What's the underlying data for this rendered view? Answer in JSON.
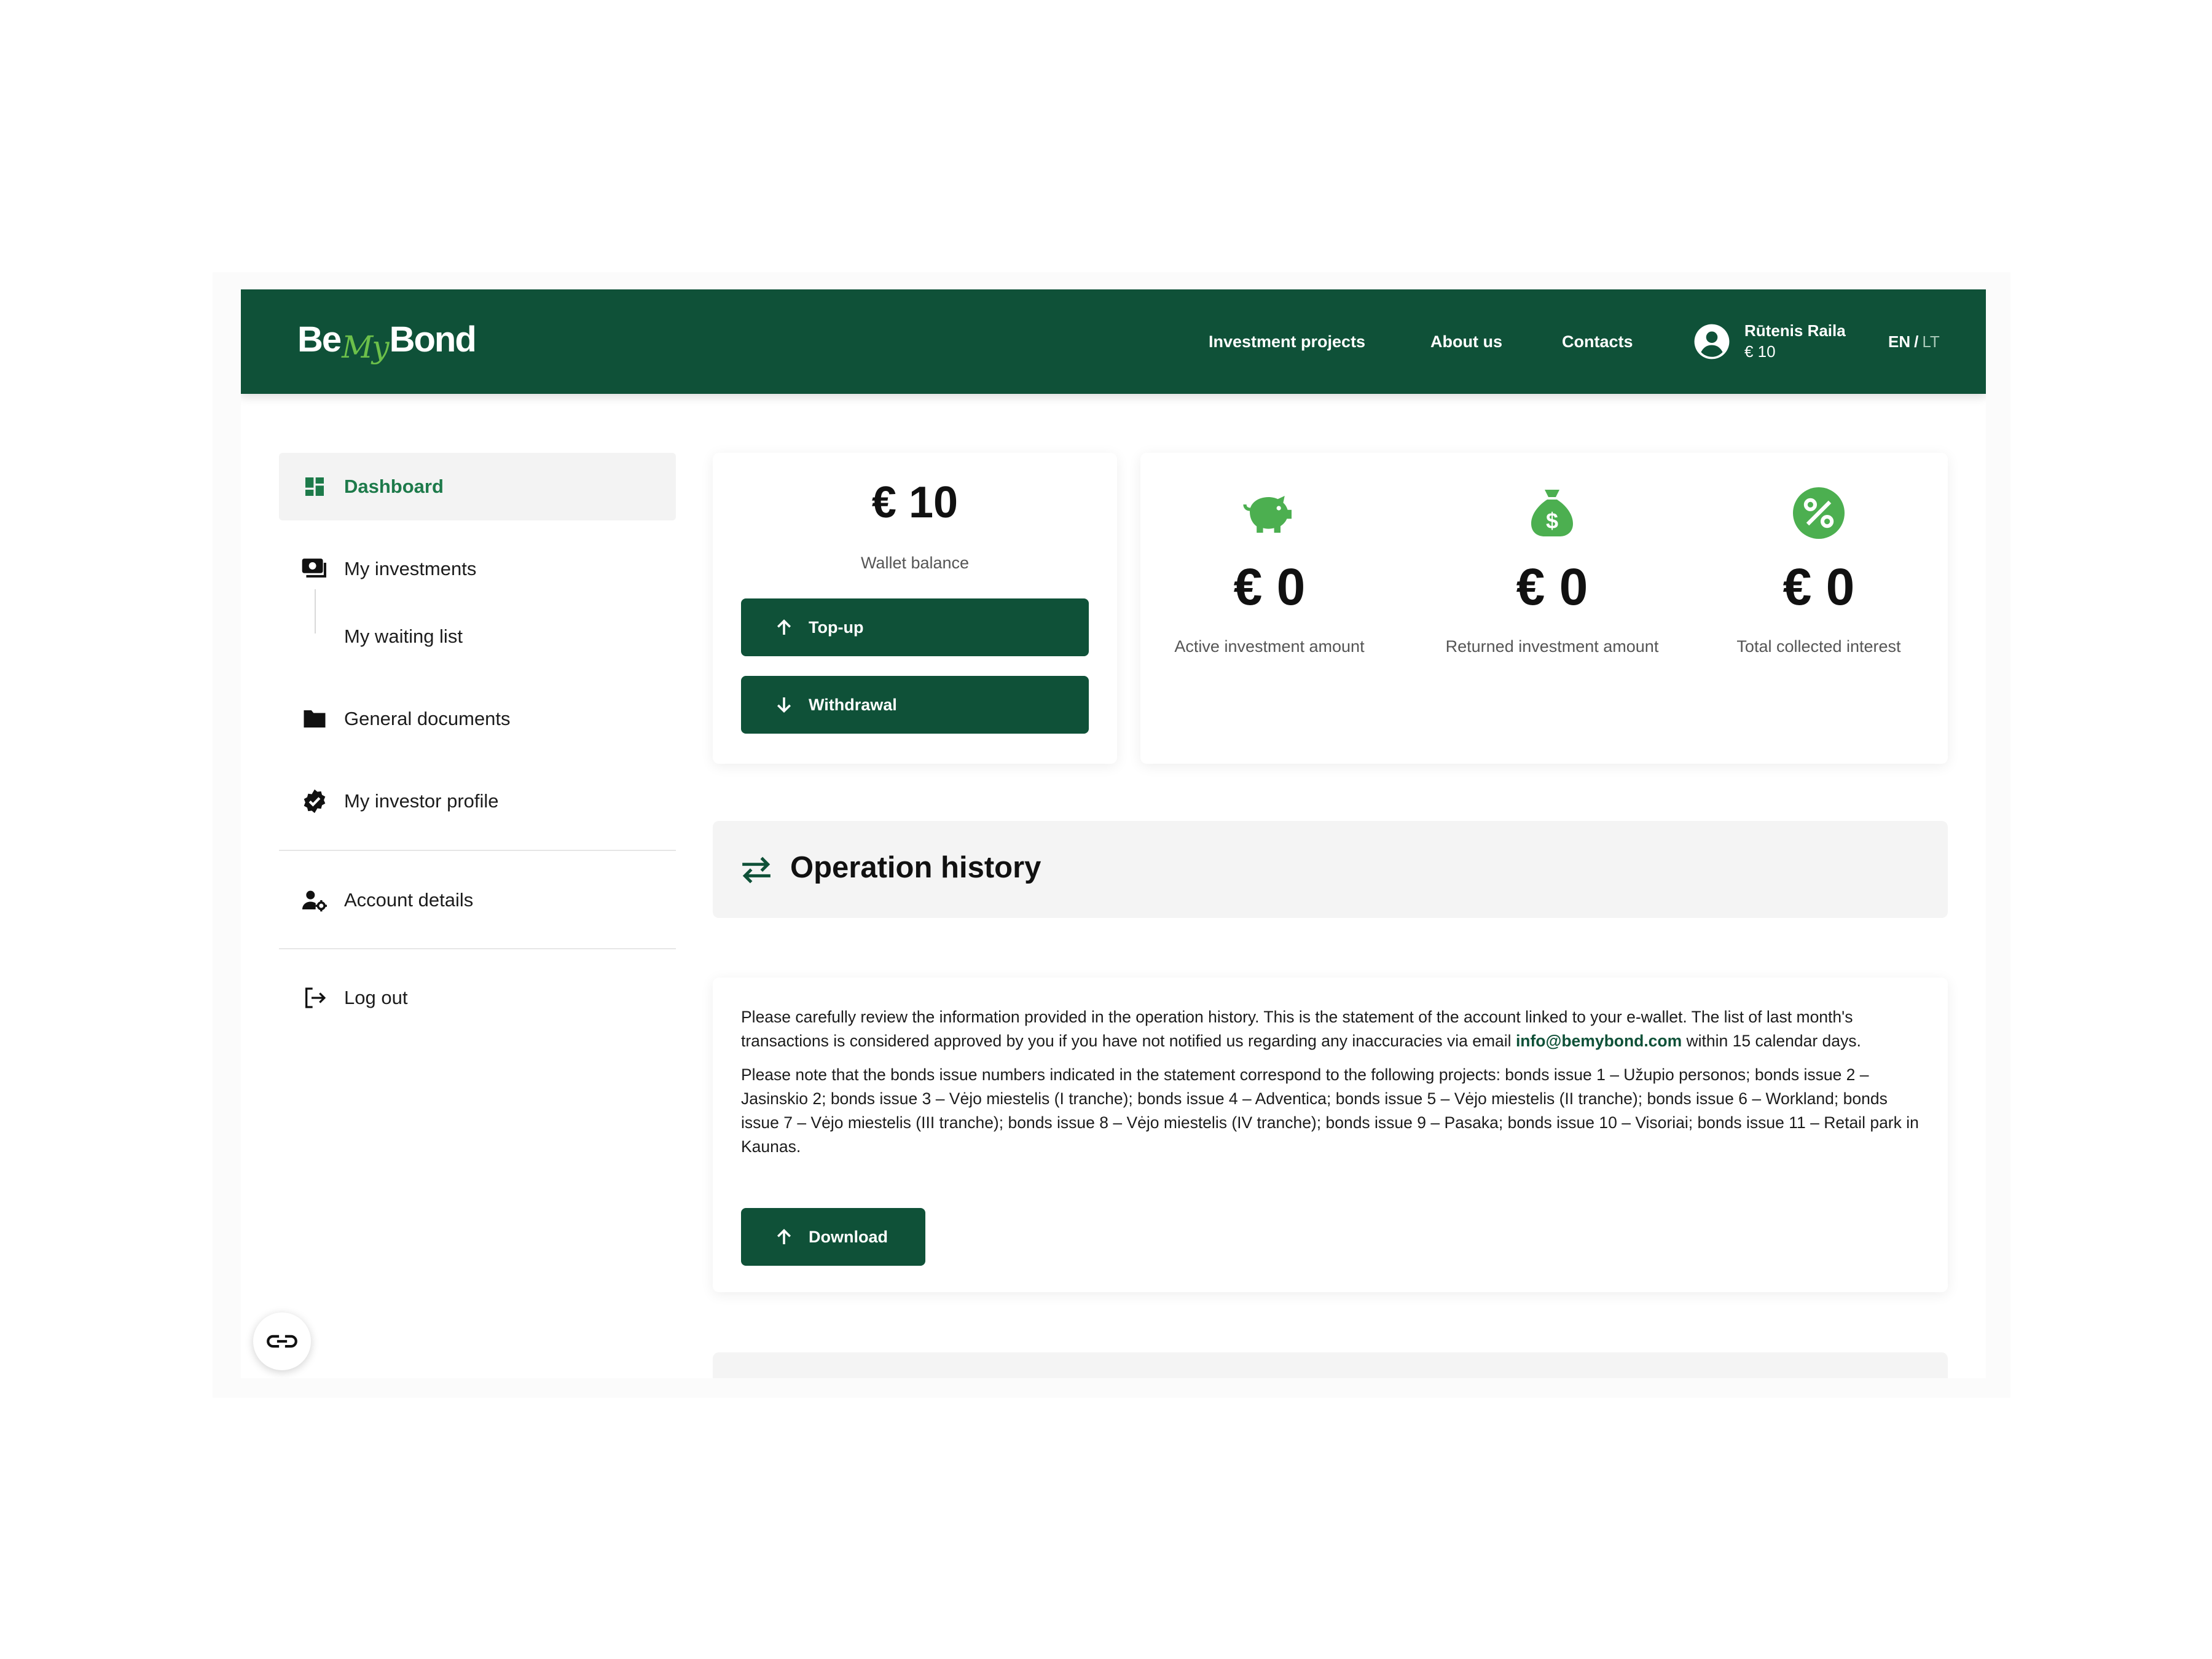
{
  "header": {
    "logo": {
      "be": "Be",
      "my": "My",
      "bond": "Bond"
    },
    "nav": [
      "Investment projects",
      "About us",
      "Contacts"
    ],
    "user": {
      "name": "Rūtenis Raila",
      "balance": "€ 10"
    },
    "lang": {
      "active": "EN",
      "separator": "/",
      "inactive": "LT"
    }
  },
  "sidebar": {
    "items": [
      {
        "label": "Dashboard",
        "icon": "dashboard-icon",
        "active": true
      },
      {
        "label": "My investments",
        "icon": "money-icon"
      },
      {
        "label": "My waiting list",
        "icon": ""
      },
      {
        "label": "General documents",
        "icon": "folder-icon"
      },
      {
        "label": "My investor profile",
        "icon": "verified-badge-icon"
      },
      {
        "label": "Account details",
        "icon": "user-settings-icon"
      },
      {
        "label": "Log out",
        "icon": "logout-icon"
      }
    ]
  },
  "wallet": {
    "amount": "€ 10",
    "label": "Wallet balance",
    "topup_label": "Top-up",
    "withdraw_label": "Withdrawal"
  },
  "stats": [
    {
      "value": "€ 0",
      "label": "Active investment amount",
      "icon": "piggy-bank-icon"
    },
    {
      "value": "€ 0",
      "label": "Returned investment amount",
      "icon": "money-bag-icon"
    },
    {
      "value": "€ 0",
      "label": "Total collected interest",
      "icon": "percent-icon"
    }
  ],
  "operation_history": {
    "title": "Operation history",
    "p1_before": "Please carefully review the information provided in the operation history. This is the statement of the account linked to your e-wallet. The list of last month's transactions is considered approved by you if you have not notified us regarding any inaccuracies via email ",
    "p1_email": "info@bemybond.com",
    "p1_after": " within 15 calendar days.",
    "p2": "Please note that the bonds issue numbers indicated in the statement correspond to the following projects: bonds issue 1 – Užupio personos; bonds issue 2 – Jasinskio 2; bonds issue 3 – Vėjo miestelis (I tranche); bonds issue 4 – Adventica; bonds issue 5 – Vėjo miestelis (II tranche); bonds issue 6 – Workland; bonds issue 7 – Vėjo miestelis (III tranche); bonds issue 8 – Vėjo miestelis (IV tranche); bonds issue 9 – Pasaka; bonds issue 10 – Visoriai; bonds issue 11 – Retail park in Kaunas.",
    "download_label": "Download"
  },
  "colors": {
    "brand_dark": "#0f5138",
    "brand_light": "#6cc04a",
    "active_text": "#1d7a4a",
    "stat_icon": "#4caf50"
  }
}
